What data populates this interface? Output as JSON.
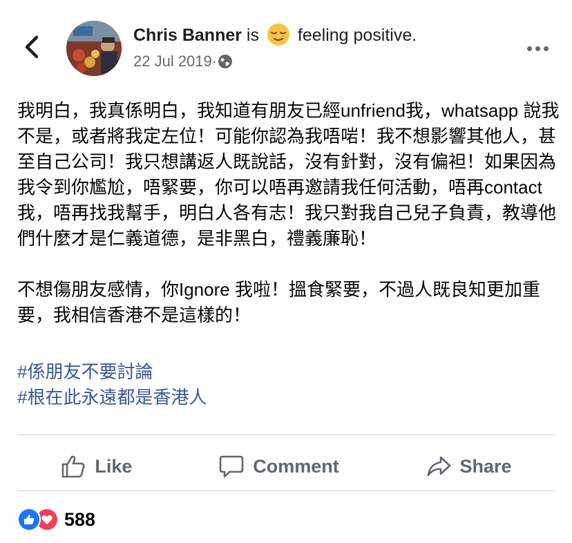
{
  "header": {
    "author": "Chris Banner",
    "status_prefix": " is ",
    "status_feeling": " feeling positive.",
    "emoji": "relieved-face-icon",
    "date": "22 Jul 2019",
    "dot": " · ",
    "privacy_icon": "globe-icon"
  },
  "post": {
    "paragraphs": [
      "我明白，我真係明白，我知道有朋友已經unfriend我，whatsapp 說我不是，或者將我定左位！可能你認為我唔啱！我不想影響其他人，甚至自己公司！我只想講返人既說話，沒有針對，沒有偏袒！如果因為我令到你尷尬，唔緊要，你可以唔再邀請我任何活動，唔再contact 我，唔再找我幫手，明白人各有志！我只對我自己兒子負責，教導他們什麼才是仁義道德，是非黑白，禮義廉恥！",
      "不想傷朋友感情，你Ignore 我啦！搵食緊要，不過人既良知更加重要，我相信香港不是這樣的！"
    ],
    "hashtags": [
      "#係朋友不要討論",
      "#根在此永遠都是香港人"
    ]
  },
  "actions": {
    "like": "Like",
    "comment": "Comment",
    "share": "Share"
  },
  "reactions": {
    "count": "588",
    "types": [
      "like-reaction-icon",
      "love-reaction-icon"
    ]
  },
  "colors": {
    "hashtag": "#385898",
    "like_blue": "#1877f2",
    "love_red": "#f33e58",
    "muted": "#65676b"
  }
}
